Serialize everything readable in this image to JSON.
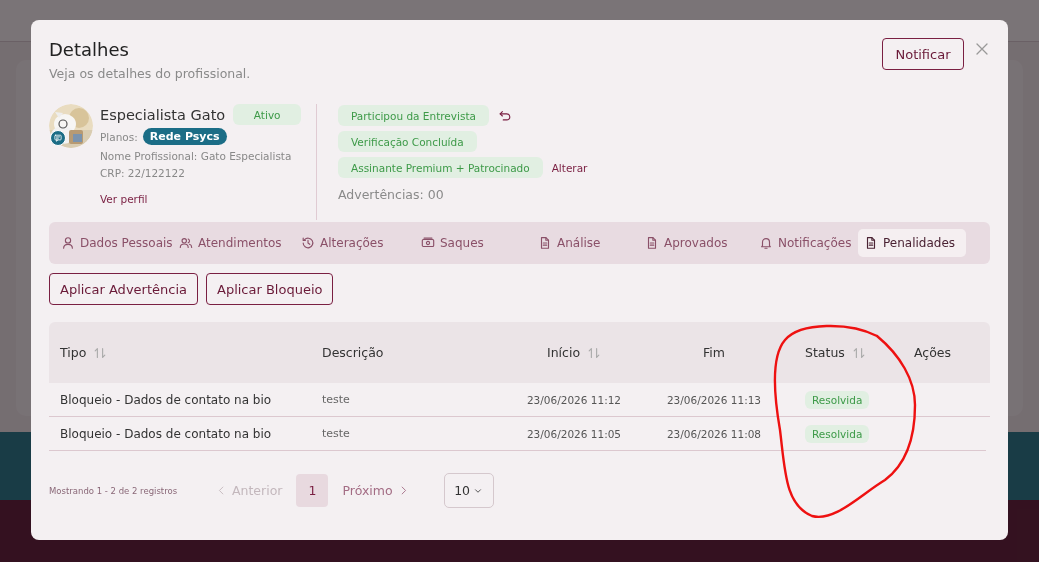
{
  "dialog": {
    "title": "Detalhes",
    "subtitle": "Veja os detalhes do profissional.",
    "notify_button": "Notificar",
    "profile": {
      "name": "Especialista Gato",
      "status": "Ativo",
      "plans_label": "Planos:",
      "plan": "Rede Psycs",
      "professional_name": "Nome Profissional: Gato Especialista",
      "crp": "CRP: 22/122122",
      "profile_link": "Ver perfil"
    },
    "tags": [
      {
        "label": "Participou da Entrevista",
        "kind": "undo"
      },
      {
        "label": "Verificação Concluída",
        "kind": "plain"
      },
      {
        "label": "Assinante Premium + Patrocinado",
        "kind": "link",
        "link": "Alterar"
      }
    ],
    "warnings": "Advertências: 00",
    "tabs": [
      {
        "label": "Dados Pessoais",
        "kind": "person",
        "selected": false
      },
      {
        "label": "Atendimentos",
        "kind": "people",
        "selected": false
      },
      {
        "label": "Alterações",
        "kind": "history",
        "selected": false
      },
      {
        "label": "Saques",
        "kind": "cash",
        "selected": false
      },
      {
        "label": "Análise",
        "kind": "document",
        "selected": false
      },
      {
        "label": "Aprovados",
        "kind": "document",
        "selected": false
      },
      {
        "label": "Notificações",
        "kind": "bell",
        "selected": false
      },
      {
        "label": "Penalidades",
        "kind": "document",
        "selected": true
      }
    ],
    "actions": [
      "Aplicar Advertência",
      "Aplicar Bloqueio"
    ],
    "table": {
      "columns": [
        {
          "label": "Tipo",
          "sortable": true
        },
        {
          "label": "Descrição",
          "sortable": false
        },
        {
          "label": "Início",
          "sortable": true
        },
        {
          "label": "Fim",
          "sortable": false
        },
        {
          "label": "Status",
          "sortable": true
        },
        {
          "label": "Ações",
          "sortable": false
        }
      ],
      "rows": [
        {
          "tipo": "Bloqueio - Dados de contato na bio",
          "descricao": "teste",
          "inicio": "23/06/2026 11:12",
          "fim": "23/06/2026 11:13",
          "status": "Resolvida"
        },
        {
          "tipo": "Bloqueio - Dados de contato na bio",
          "descricao": "teste",
          "inicio": "23/06/2026 11:05",
          "fim": "23/06/2026 11:08",
          "status": "Resolvida"
        }
      ]
    },
    "pagination": {
      "summary": "Mostrando 1 - 2 de 2 registros",
      "previous": {
        "label": "Anterior",
        "disabled": true
      },
      "pages": [
        {
          "label": "1",
          "selected": true
        }
      ],
      "next": {
        "label": "Próximo",
        "disabled": false
      },
      "page_size": "10"
    }
  }
}
